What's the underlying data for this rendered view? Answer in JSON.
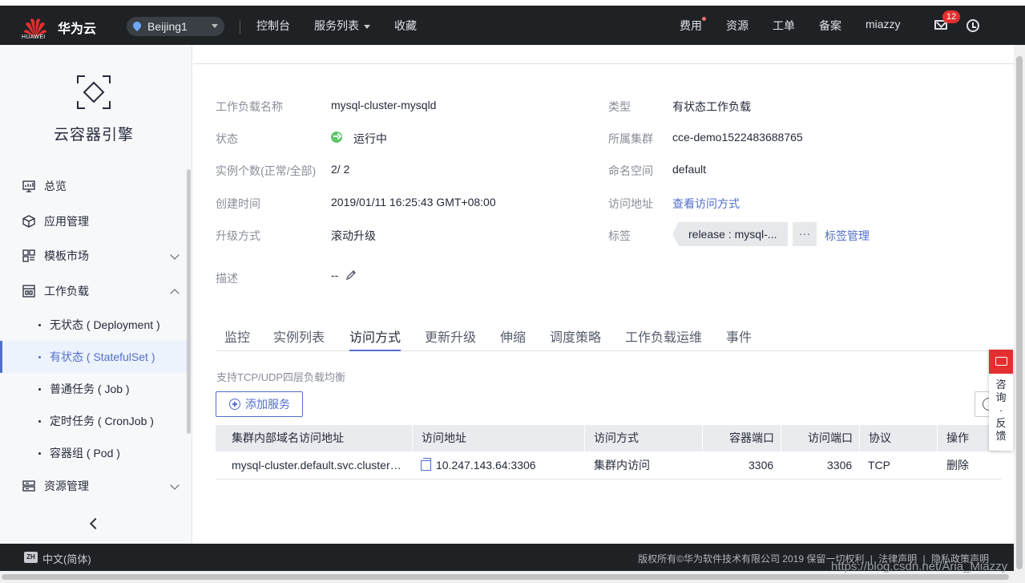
{
  "header": {
    "logo_text": "HUAWEI",
    "brand": "华为云",
    "region": "Beijing1",
    "nav": [
      "控制台",
      "服务列表",
      "收藏"
    ],
    "right_nav": [
      "费用",
      "资源",
      "工单",
      "备案",
      "miazzy"
    ],
    "mail_badge": "12"
  },
  "sidebar": {
    "service_title": "云容器引擎",
    "items": [
      {
        "label": "总览"
      },
      {
        "label": "应用管理"
      },
      {
        "label": "模板市场"
      },
      {
        "label": "工作负载"
      }
    ],
    "sub_items": [
      {
        "label": "无状态 ( Deployment )"
      },
      {
        "label": "有状态 ( StatefulSet )"
      },
      {
        "label": "普通任务 ( Job )"
      },
      {
        "label": "定时任务 ( CronJob )"
      },
      {
        "label": "容器组 ( Pod )"
      }
    ],
    "resource_item": "资源管理"
  },
  "detail": {
    "left": [
      {
        "label": "工作负载名称",
        "value": "mysql-cluster-mysqld"
      },
      {
        "label": "状态",
        "value": "运行中"
      },
      {
        "label": "实例个数(正常/全部)",
        "value": "2/ 2"
      },
      {
        "label": "创建时间",
        "value": "2019/01/11 16:25:43 GMT+08:00"
      },
      {
        "label": "升级方式",
        "value": "滚动升级"
      },
      {
        "label": "描述",
        "value": "--"
      }
    ],
    "right": [
      {
        "label": "类型",
        "value": "有状态工作负载"
      },
      {
        "label": "所属集群",
        "value": "cce-demo1522483688765"
      },
      {
        "label": "命名空间",
        "value": "default"
      },
      {
        "label": "访问地址",
        "value": "查看访问方式"
      },
      {
        "label": "标签",
        "value": "release : mysql-..."
      }
    ],
    "tag_more": "···",
    "tag_manage": "标签管理"
  },
  "tabs": [
    "监控",
    "实例列表",
    "访问方式",
    "更新升级",
    "伸缩",
    "调度策略",
    "工作负载运维",
    "事件"
  ],
  "active_tab": "访问方式",
  "access": {
    "hint": "支持TCP/UDP四层负载均衡",
    "add_button": "添加服务",
    "columns": [
      "集群内部域名访问地址",
      "访问地址",
      "访问方式",
      "容器端口",
      "访问端口",
      "协议",
      "操作"
    ],
    "rows": [
      {
        "domain": "mysql-cluster.default.svc.cluster…",
        "address": "10.247.143.64:3306",
        "method": "集群内访问",
        "container_port": "3306",
        "access_port": "3306",
        "protocol": "TCP",
        "action": "删除"
      }
    ]
  },
  "feedback": {
    "text": "咨询·反馈"
  },
  "footer": {
    "lang_icon": "ZH",
    "lang": "中文(简体)",
    "copyright": "版权所有©华为软件技术有限公司 2019 保留一切权利",
    "links": [
      "法律声明",
      "隐私政策声明"
    ]
  },
  "watermark": "https://blog.csdn.net/Aria_Miazzy"
}
